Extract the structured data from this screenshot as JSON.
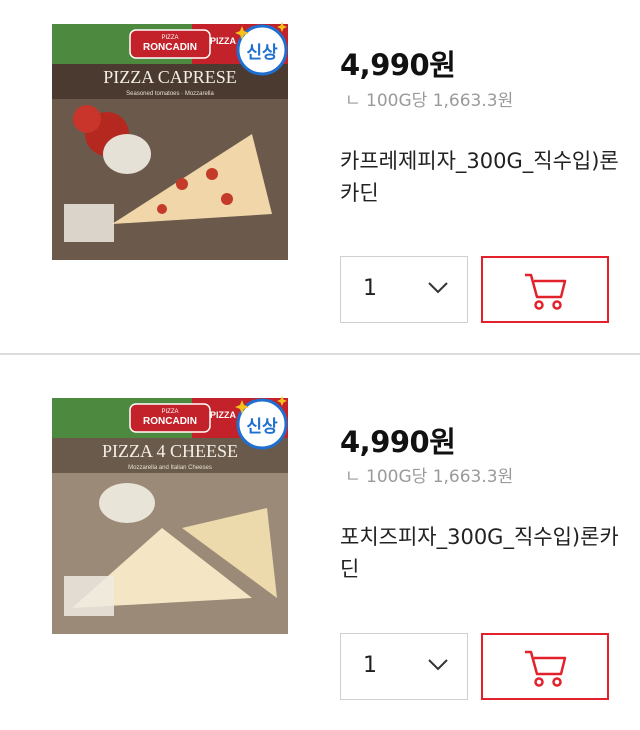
{
  "products": [
    {
      "image_brand": "RONCADIN",
      "image_brand_top": "PIZZA",
      "image_title": "PIZZA CAPRESE",
      "image_subtitle": "Seasoned tomatoes · Mozzarella",
      "image_corner_tag": "PIZZA",
      "badge": "신상",
      "price": "4,990원",
      "unit_price": "ㄴ 100G당 1,663.3원",
      "name": "카프레제피자_300G_직수입)론카딘",
      "quantity": "1"
    },
    {
      "image_brand": "RONCADIN",
      "image_brand_top": "PIZZA",
      "image_title": "PIZZA 4 CHEESE",
      "image_subtitle": "Mozzarella and Italian Cheeses",
      "image_corner_tag": "PIZZA",
      "badge": "신상",
      "price": "4,990원",
      "unit_price": "ㄴ 100G당 1,663.3원",
      "name": "포치즈피자_300G_직수입)론카딘",
      "quantity": "1"
    }
  ],
  "colors": {
    "accent": "#e3212b",
    "badge_blue": "#1f6fd1",
    "border": "#cfcfcf"
  },
  "icons": {
    "cart": "cart-icon",
    "dropdown": "chevron-down-icon",
    "badge": "new-badge-icon"
  }
}
